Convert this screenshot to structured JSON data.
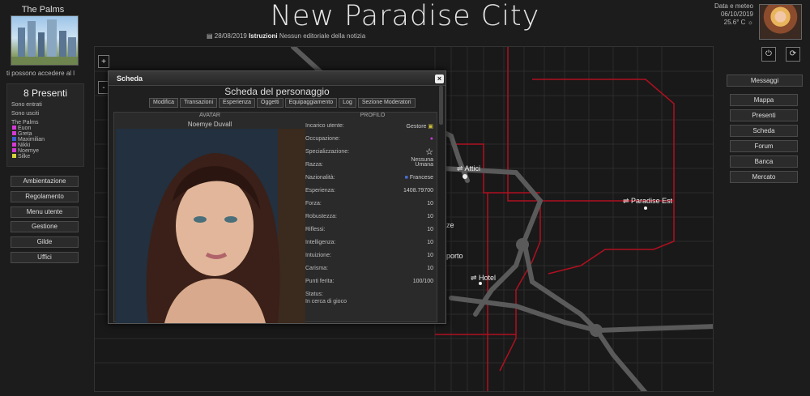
{
  "header": {
    "site_title": "New Paradise City",
    "location_name": "The Palms",
    "location_marquee": "ti possono accedere al l",
    "news": {
      "date": "28/08/2019",
      "label": "Istruzioni",
      "text": "Nessun editoriale della notizia"
    },
    "weather": {
      "label": "Data e meteo",
      "date": "06/10/2019",
      "temp": "25.6° C"
    }
  },
  "icons": {
    "power": "power-icon",
    "refresh": "refresh-icon",
    "sun": "sun-icon",
    "news": "newspaper-icon"
  },
  "presence": {
    "count_label": "8 Presenti",
    "entered_label": "Sono entrati",
    "exited_label": "Sono usciti",
    "location_label": "The Palms",
    "users": [
      {
        "name": "Euon",
        "color": "#d43ad4"
      },
      {
        "name": "Greta",
        "color": "#d43ad4"
      },
      {
        "name": "Maximilian",
        "color": "#3a5ed4"
      },
      {
        "name": "Nikki",
        "color": "#d43ad4"
      },
      {
        "name": "Noemye",
        "color": "#d43ad4"
      },
      {
        "name": "Silke",
        "color": "#d4d43a"
      }
    ]
  },
  "left_menu": [
    "Ambientazione",
    "Regolamento",
    "Menu utente",
    "Gestione",
    "Gilde",
    "Uffici"
  ],
  "zoom": {
    "plus": "+",
    "minus": "-"
  },
  "right_menu": [
    "Messaggi",
    "Mappa",
    "Presenti",
    "Scheda",
    "Forum",
    "Banca",
    "Mercato"
  ],
  "map": {
    "labels": [
      "Attici",
      "Paradise Est",
      "Hotel",
      "porto",
      "ze"
    ],
    "road_color": "#5a5a5a",
    "border_color": "#b01020"
  },
  "dialog": {
    "title": "Scheda",
    "close": "×",
    "heading": "Scheda del personaggio",
    "tabs": [
      "Modifica",
      "Transazioni",
      "Esperienza",
      "Oggetti",
      "Equipaggiamento",
      "Log",
      "Sezione Moderatori"
    ],
    "avatar_label": "AVATAR",
    "character_name": "Noemye Duvall",
    "profile_label": "PROFILO",
    "profile": [
      {
        "key": "Incarico utente:",
        "value": "Gestore"
      },
      {
        "key": "Occupazione:",
        "value": ""
      },
      {
        "key": "Specializzazione:",
        "value": "Nessuna"
      },
      {
        "key": "Razza:",
        "value": "Umana"
      },
      {
        "key": "Nazionalità:",
        "value": "Francese"
      },
      {
        "key": "Esperienza:",
        "value": "1408.79700"
      },
      {
        "key": "Forza:",
        "value": "10"
      },
      {
        "key": "Robustezza:",
        "value": "10"
      },
      {
        "key": "Riflessi:",
        "value": "10"
      },
      {
        "key": "Intelligenza:",
        "value": "10"
      },
      {
        "key": "Intuizione:",
        "value": "10"
      },
      {
        "key": "Carisma:",
        "value": "10"
      },
      {
        "key": "Punti ferita:",
        "value": "100/100"
      },
      {
        "key": "Status:",
        "value": "In cerca di gioco"
      }
    ]
  }
}
